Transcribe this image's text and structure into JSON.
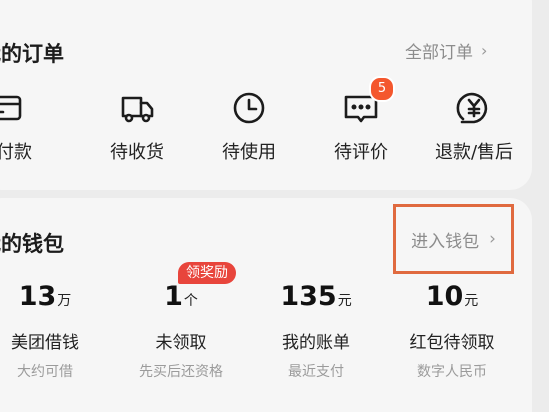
{
  "orders": {
    "title": "我的订单",
    "more": "全部订单",
    "items": [
      {
        "label": "待付款",
        "icon": "card-icon"
      },
      {
        "label": "待收货",
        "icon": "truck-icon"
      },
      {
        "label": "待使用",
        "icon": "clock-icon"
      },
      {
        "label": "待评价",
        "icon": "comment-icon",
        "badge": "5"
      },
      {
        "label": "退款/售后",
        "icon": "yuan-refund-icon"
      }
    ]
  },
  "wallet": {
    "title": "我的钱包",
    "enter": "进入钱包",
    "reward_tag": "领奖励",
    "stats": [
      {
        "value": "13",
        "unit": "万",
        "name": "美团借钱",
        "sub": "大约可借"
      },
      {
        "value": "1",
        "unit": "个",
        "name": "未领取",
        "sub": "先买后还资格"
      },
      {
        "value": "135",
        "unit": "元",
        "name": "我的账单",
        "sub": "最近支付"
      },
      {
        "value": "10",
        "unit": "元",
        "name": "红包待领取",
        "sub": "数字人民币"
      }
    ]
  },
  "colors": {
    "badge": "#f4572d",
    "reward": "#e8453c",
    "highlight_border": "#e06a3f"
  }
}
